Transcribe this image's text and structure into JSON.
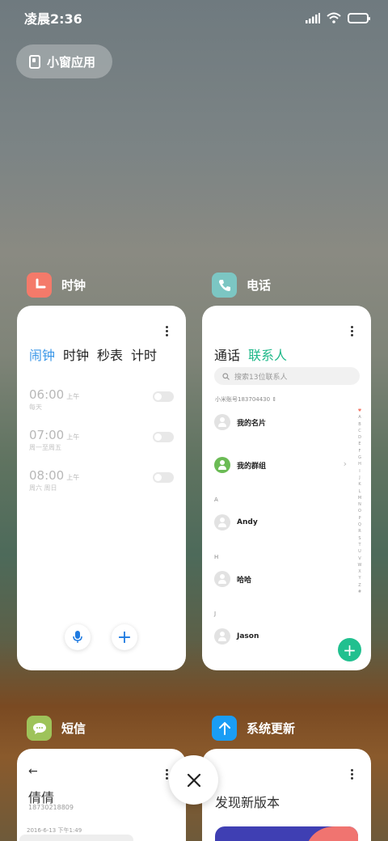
{
  "status_bar": {
    "time": "凌晨2:36"
  },
  "floating_window": {
    "label": "小窗应用"
  },
  "apps": {
    "clock": {
      "name": "时钟",
      "icon": "clock-icon",
      "color": "#f47a6a",
      "tabs": [
        "闹钟",
        "时钟",
        "秒表",
        "计时"
      ],
      "alarms": [
        {
          "time": "06:00",
          "ampm": "上午",
          "repeat": "每天"
        },
        {
          "time": "07:00",
          "ampm": "上午",
          "repeat": "周一至周五"
        },
        {
          "time": "08:00",
          "ampm": "上午",
          "repeat": "周六 周日"
        }
      ]
    },
    "phone": {
      "name": "电话",
      "icon": "phone-icon",
      "color": "#7cc6c3",
      "tabs": [
        "通话",
        "联系人"
      ],
      "search_placeholder": "搜索13位联系人",
      "account": "小米账号183704430",
      "my_card": "我的名片",
      "my_groups": "我的群组",
      "sections": [
        {
          "letter": "A",
          "name": "Andy"
        },
        {
          "letter": "H",
          "name": "哈哈"
        },
        {
          "letter": "J",
          "name": "Jason"
        }
      ],
      "index_letters": [
        "♥",
        "A",
        "B",
        "C",
        "D",
        "E",
        "F",
        "G",
        "H",
        "I",
        "J",
        "K",
        "L",
        "M",
        "N",
        "O",
        "P",
        "Q",
        "R",
        "S",
        "T",
        "U",
        "V",
        "W",
        "X",
        "Y",
        "Z",
        "#"
      ]
    },
    "sms": {
      "name": "短信",
      "icon": "message-icon",
      "color": "#9ec35a",
      "contact_name": "倩倩",
      "number": "18730218809",
      "date": "2016-6-13 下午1:49"
    },
    "update": {
      "name": "系统更新",
      "icon": "update-arrow-icon",
      "color": "#1a9df5",
      "headline": "发现新版本"
    }
  },
  "close_button": {
    "icon": "close-icon"
  }
}
